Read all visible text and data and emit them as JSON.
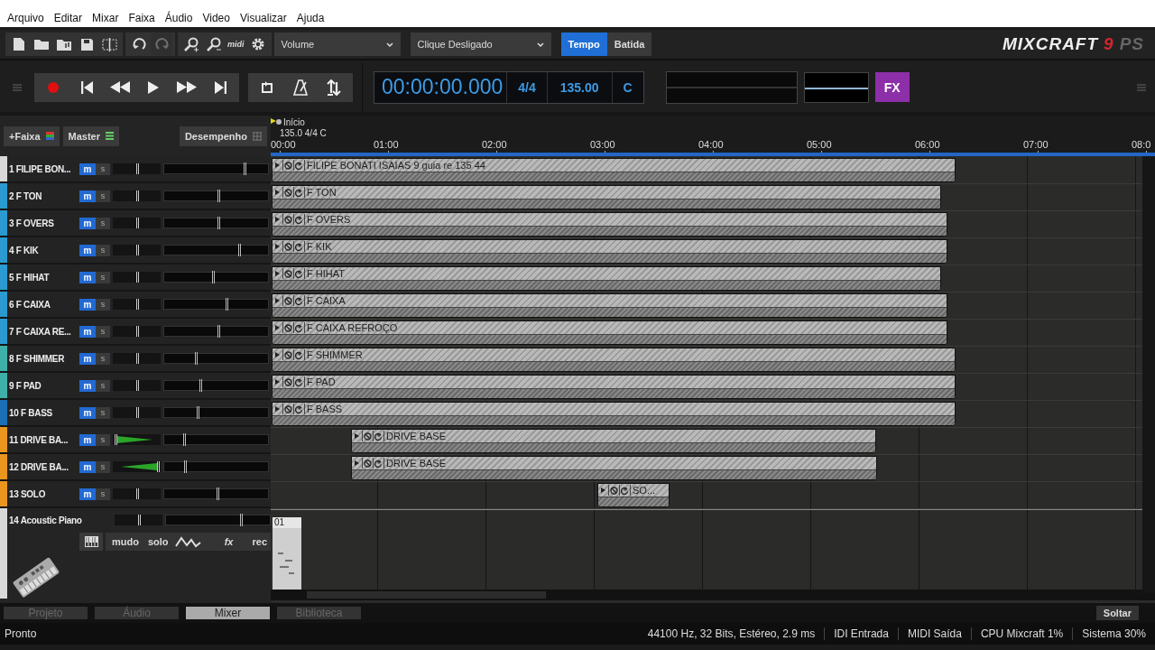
{
  "menu": [
    "Arquivo",
    "Editar",
    "Mixar",
    "Faixa",
    "Áudio",
    "Video",
    "Visualizar",
    "Ajuda"
  ],
  "toolbar": {
    "buttons": [
      {
        "kind": "new",
        "disabled": false
      },
      {
        "kind": "open",
        "disabled": false
      },
      {
        "kind": "music",
        "disabled": false
      },
      {
        "kind": "save",
        "disabled": false
      },
      {
        "kind": "split",
        "disabled": false
      },
      {
        "kind": "undo",
        "disabled": false
      },
      {
        "kind": "redo",
        "disabled": true
      },
      {
        "kind": "zoomin",
        "disabled": false
      },
      {
        "kind": "zoomout",
        "disabled": false
      }
    ],
    "midi": "midi",
    "dropdowns": [
      "Volume",
      "Clique Desligado"
    ],
    "modes": [
      {
        "label": "Tempo",
        "selected": true
      },
      {
        "label": "Batida",
        "selected": false
      }
    ]
  },
  "logo": {
    "name": "MIXCRAFT",
    "version": "9",
    "edition": "PS"
  },
  "transport": {
    "time": "00:00:00.000",
    "signature": "4/4",
    "tempo": "135.00",
    "key": "C",
    "fx": "FX"
  },
  "track_header": {
    "add": "+Faixa",
    "master": "Master",
    "performance": "Desempenho"
  },
  "ruler": {
    "marker": "Início",
    "info": "135.0 4/4 C",
    "ticks": [
      "00:00",
      "01:00",
      "02:00",
      "03:00",
      "04:00",
      "05:00",
      "06:00",
      "07:00",
      "08:0"
    ]
  },
  "tracks": [
    {
      "name": "1 FILIPE BON...",
      "color": "#d8d8d8",
      "mute": "m",
      "solo": "s",
      "pan": {
        "level": 0.5
      },
      "volume": {
        "level": 0.77
      },
      "clip": "FILIPE BONATI ISAIAS 9 guia re 135 44"
    },
    {
      "name": "2 F TON",
      "color": "#2a9ad0",
      "mute": "m",
      "solo": "s",
      "pan": {
        "level": 0.5
      },
      "volume": {
        "level": 0.52
      },
      "clip": "F TON"
    },
    {
      "name": "3 F OVERS",
      "color": "#2a9ad0",
      "mute": "m",
      "solo": "s",
      "pan": {
        "level": 0.5
      },
      "volume": {
        "level": 0.52
      },
      "clip": "F OVERS"
    },
    {
      "name": "4 F KIK",
      "color": "#2a9ad0",
      "mute": "m",
      "solo": "s",
      "pan": {
        "level": 0.5
      },
      "volume": {
        "level": 0.72
      },
      "clip": "F KIK"
    },
    {
      "name": "5 F HIHAT",
      "color": "#2a9ad0",
      "mute": "m",
      "solo": "s",
      "pan": {
        "level": 0.5
      },
      "volume": {
        "level": 0.47
      },
      "clip": "F HIHAT"
    },
    {
      "name": "6 F CAIXA",
      "color": "#2a9ad0",
      "mute": "m",
      "solo": "s",
      "pan": {
        "level": 0.5
      },
      "volume": {
        "level": 0.6
      },
      "clip": "F CAIXA"
    },
    {
      "name": "7 F CAIXA RE...",
      "color": "#2a9ad0",
      "mute": "m",
      "solo": "s",
      "pan": {
        "level": 0.5
      },
      "volume": {
        "level": 0.52
      },
      "clip": "F CAIXA REFROÇO"
    },
    {
      "name": "8 F SHIMMER",
      "color": "#3fb0a8",
      "mute": "m",
      "solo": "s",
      "pan": {
        "level": 0.5
      },
      "volume": {
        "level": 0.3
      },
      "clip": "F SHIMMER"
    },
    {
      "name": "9 F PAD",
      "color": "#3fb0a8",
      "mute": "m",
      "solo": "s",
      "pan": {
        "level": 0.5
      },
      "volume": {
        "level": 0.35
      },
      "clip": "F PAD"
    },
    {
      "name": "10 F BASS",
      "color": "#1a6fb5",
      "mute": "m",
      "solo": "s",
      "pan": {
        "level": 0.5
      },
      "volume": {
        "level": 0.32
      },
      "clip": "F BASS"
    },
    {
      "name": "11 DRIVE BA...",
      "color": "#e8961e",
      "mute": "m",
      "solo": "s",
      "pan": {
        "level": 0.05
      },
      "volume": {
        "level": 0.19
      },
      "clip": "DRIVE BASE"
    },
    {
      "name": "12 DRIVE BA...",
      "color": "#e8961e",
      "mute": "m",
      "solo": "s",
      "pan": {
        "level": 0.95
      },
      "volume": {
        "level": 0.2
      },
      "clip": "DRIVE BASE"
    },
    {
      "name": "13 SOLO",
      "color": "#e8961e",
      "mute": "m",
      "solo": "s",
      "pan": {
        "level": 0.5
      },
      "volume": {
        "level": 0.51
      },
      "clip": "SO..."
    }
  ],
  "instrument_track": {
    "name": "14 Acoustic Piano",
    "color": "#d8d8d8",
    "pan": {
      "level": 0.5
    },
    "volume": {
      "level": 0.72
    },
    "controls": [
      "mudo",
      "solo",
      "fx",
      "rec"
    ],
    "clip": "01"
  },
  "bottom_tabs": [
    {
      "label": "Projeto",
      "selected": false
    },
    {
      "label": "Áudio",
      "selected": false
    },
    {
      "label": "Mixer",
      "selected": true
    },
    {
      "label": "Biblioteca",
      "selected": false
    }
  ],
  "undock": "Soltar",
  "status_bar": {
    "state": "Pronto",
    "audio": "44100 Hz, 32 Bits, Estéreo, 2.9 ms",
    "midi_in": "IDI Entrada",
    "midi_out": "MIDI Saída",
    "cpu": "CPU Mixcraft 1%",
    "system": "Sistema 30%"
  }
}
